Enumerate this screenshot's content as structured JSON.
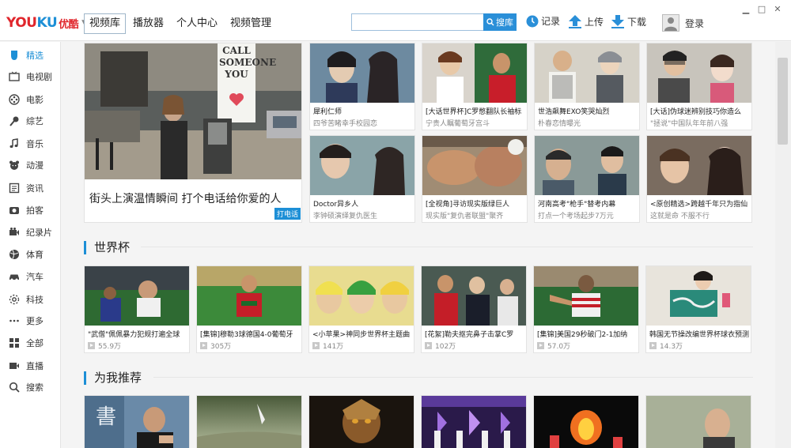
{
  "topbar": {
    "logo_text_1": "YOU",
    "logo_text_2": "KU",
    "logo_cn": "优酷",
    "nav": [
      "视频库",
      "播放器",
      "个人中心",
      "视频管理"
    ],
    "search_placeholder": "",
    "search_button": "搜库",
    "record": "记录",
    "upload": "上传",
    "download": "下载",
    "login": "登录"
  },
  "sidebar": {
    "items": [
      {
        "label": "精选",
        "icon": "featured-icon"
      },
      {
        "label": "电视剧",
        "icon": "tv-icon"
      },
      {
        "label": "电影",
        "icon": "film-reel-icon"
      },
      {
        "label": "综艺",
        "icon": "microphone-icon"
      },
      {
        "label": "音乐",
        "icon": "music-note-icon"
      },
      {
        "label": "动漫",
        "icon": "bear-icon"
      },
      {
        "label": "资讯",
        "icon": "news-icon"
      },
      {
        "label": "拍客",
        "icon": "camera-icon"
      },
      {
        "label": "纪录片",
        "icon": "video-camera-icon"
      },
      {
        "label": "体育",
        "icon": "ball-icon"
      },
      {
        "label": "汽车",
        "icon": "car-icon"
      },
      {
        "label": "科技",
        "icon": "tech-icon"
      },
      {
        "label": "更多",
        "icon": "more-icon"
      },
      {
        "label": "全部",
        "icon": "grid-icon"
      },
      {
        "label": "直播",
        "icon": "live-icon"
      },
      {
        "label": "搜索",
        "icon": "search-icon"
      }
    ]
  },
  "featured": {
    "main": {
      "title": "街头上演温情瞬间 打个电话给你爱的人",
      "tag": "打电话",
      "sign_text": "CALL SOMEONE YOU"
    },
    "grid": [
      {
        "title": "犀利仁师",
        "sub": "四爷苦睹幸手校园恋"
      },
      {
        "title": "[大话世界杯]C罗憋翻队长袖标",
        "sub": "宁贵人瞩葡萄牙宫斗"
      },
      {
        "title": "世浩飙舞EXO笑哭灿烈",
        "sub": "朴春恋情曝光"
      },
      {
        "title": "[大话]伪球迷辨别技巧你造么",
        "sub": "\"拯说\"中国队年年前八强"
      },
      {
        "title": "Doctor异乡人",
        "sub": "李钟硕演绎复仇医生"
      },
      {
        "title": "[全视角]寻访现实版绿巨人",
        "sub": "现实版\"复仇者联盟\"聚齐"
      },
      {
        "title": "河南高考\"枪手\"替考内幕",
        "sub": "打点一个考场起步7万元"
      },
      {
        "title": "<原创精选>跨越千年只为指仙",
        "sub": "这就是命 不服不行"
      }
    ]
  },
  "worldcup": {
    "title": "世界杯",
    "items": [
      {
        "title": "\"武僧\"佩佩暴力犯规打遍全球",
        "views": "55.9万"
      },
      {
        "title": "[集锦]穆勒3球德国4-0葡萄牙",
        "views": "305万"
      },
      {
        "title": "<小苹果>神同步世界杯主题曲",
        "views": "141万"
      },
      {
        "title": "[花絮]勒夫抠完鼻子击掌C罗",
        "views": "102万"
      },
      {
        "title": "[集锦]美国29秒破门2-1加纳",
        "views": "57.0万"
      },
      {
        "title": "韩国无节操改编世界杯球衣预测",
        "views": "14.3万"
      }
    ]
  },
  "recommend": {
    "title": "为我推荐",
    "thumb_text": "書"
  },
  "colors": {
    "accent": "#1d8fd6",
    "brand_red": "#e0262c"
  }
}
